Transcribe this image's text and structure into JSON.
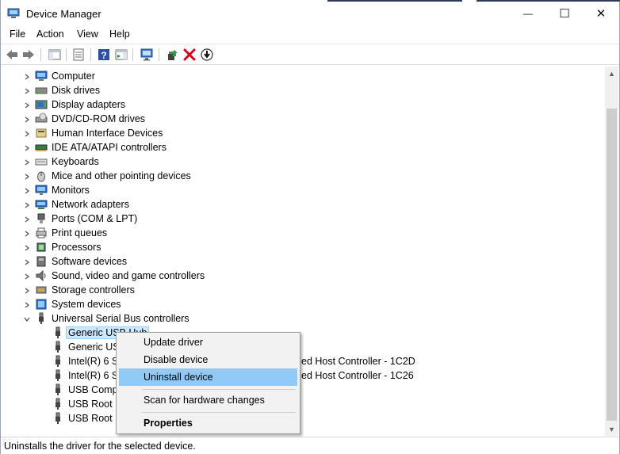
{
  "window": {
    "title": "Device Manager",
    "minimize_glyph": "—",
    "maximize_glyph": "☐",
    "close_glyph": "✕"
  },
  "menubar": {
    "items": [
      "File",
      "Action",
      "View",
      "Help"
    ]
  },
  "toolbar": {
    "icons": [
      "back-arrow-icon",
      "forward-arrow-icon",
      "show-hide-console-tree-icon",
      "properties-icon",
      "help-icon",
      "action-pane-icon",
      "scan-monitor-icon",
      "update-driver-icon",
      "uninstall-device-icon",
      "disable-device-icon"
    ]
  },
  "tree": {
    "categories": [
      {
        "label": "Computer",
        "icon": "computer-icon"
      },
      {
        "label": "Disk drives",
        "icon": "disk-drive-icon"
      },
      {
        "label": "Display adapters",
        "icon": "display-adapter-icon"
      },
      {
        "label": "DVD/CD-ROM drives",
        "icon": "dvd-drive-icon"
      },
      {
        "label": "Human Interface Devices",
        "icon": "hid-icon"
      },
      {
        "label": "IDE ATA/ATAPI controllers",
        "icon": "ide-controller-icon"
      },
      {
        "label": "Keyboards",
        "icon": "keyboard-icon"
      },
      {
        "label": "Mice and other pointing devices",
        "icon": "mouse-icon"
      },
      {
        "label": "Monitors",
        "icon": "monitor-icon"
      },
      {
        "label": "Network adapters",
        "icon": "network-adapter-icon"
      },
      {
        "label": "Ports (COM & LPT)",
        "icon": "port-icon"
      },
      {
        "label": "Print queues",
        "icon": "printer-icon"
      },
      {
        "label": "Processors",
        "icon": "processor-icon"
      },
      {
        "label": "Software devices",
        "icon": "software-device-icon"
      },
      {
        "label": "Sound, video and game controllers",
        "icon": "sound-icon"
      },
      {
        "label": "Storage controllers",
        "icon": "storage-controller-icon"
      },
      {
        "label": "System devices",
        "icon": "system-device-icon"
      },
      {
        "label": "Universal Serial Bus controllers",
        "icon": "usb-icon"
      }
    ],
    "usb_children": [
      {
        "label": "Generic USB Hub",
        "right_label": ""
      },
      {
        "label": "Generic USB Hub",
        "right_label": ""
      },
      {
        "label": "Intel(R) 6 Series/C200 Series Chipset Family USB Enhanced Host Controller - 1C2D",
        "right_label": "ed Host Controller - 1C2D"
      },
      {
        "label": "Intel(R) 6 Series/C200 Series Chipset Family USB Enhanced Host Controller - 1C26",
        "right_label": "ed Host Controller - 1C26"
      },
      {
        "label": "USB Composite Device",
        "right_label": ""
      },
      {
        "label": "USB Root Hub",
        "right_label": ""
      },
      {
        "label": "USB Root Hub",
        "right_label": ""
      }
    ],
    "usb_children_visible": [
      "Generic USB Hub",
      "Generic USB",
      "Intel(R) 6 Se",
      "Intel(R) 6 Se",
      "USB Compo",
      "USB Root H",
      "USB Root H"
    ]
  },
  "context_menu": {
    "items": [
      {
        "label": "Update driver",
        "highlighted": false,
        "bold": false
      },
      {
        "label": "Disable device",
        "highlighted": false,
        "bold": false
      },
      {
        "label": "Uninstall device",
        "highlighted": true,
        "bold": false
      },
      {
        "label": "Scan for hardware changes",
        "highlighted": false,
        "bold": false
      },
      {
        "label": "Properties",
        "highlighted": false,
        "bold": true
      }
    ]
  },
  "statusbar": {
    "text": "Uninstalls the driver for the selected device."
  },
  "colors": {
    "selection": "#cce8ff",
    "menu_highlight": "#91c9f7",
    "menu_bg": "#f2f2f2"
  }
}
